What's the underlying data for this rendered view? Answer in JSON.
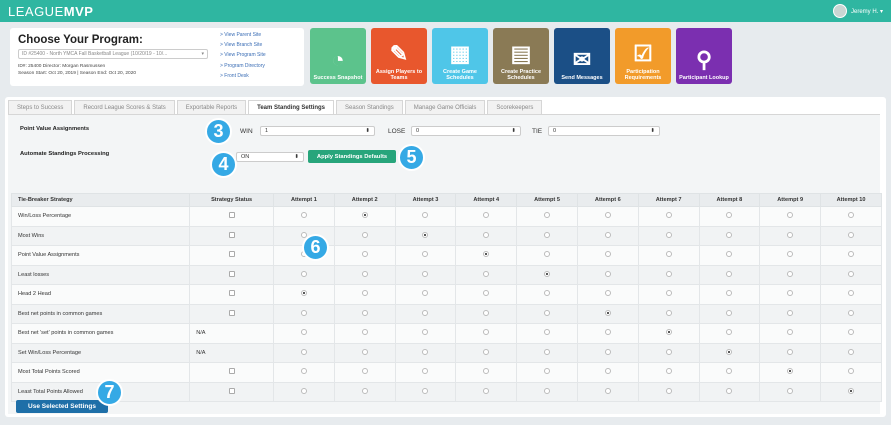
{
  "topbar": {
    "logo_a": "LEAGUE",
    "logo_b": "MVP",
    "user": "Jeremy H. ▾"
  },
  "program": {
    "title": "Choose Your Program:",
    "select": "ID #25400 - North YMCA Fall Basketball League (10/20/19 - 10/...",
    "meta1": "ID#: 25400       Director: Morgan Rasmussen",
    "meta2": "Season Start: Oct 20, 2019  |  Season End: Oct 20, 2020",
    "links": [
      "> View Parent Site",
      "> View Branch Site",
      "> View Program Site",
      "> Program Directory",
      "> Front Desk"
    ]
  },
  "tiles": [
    {
      "label": "Success Snapshot",
      "color": "#5cc38c",
      "icon": "gauge-icon",
      "glyph": "◔"
    },
    {
      "label": "Assign Players to Teams",
      "color": "#e8572d",
      "icon": "assign-icon",
      "glyph": "✎"
    },
    {
      "label": "Create Game Schedules",
      "color": "#4fc6e8",
      "icon": "calendar-icon",
      "glyph": "▦"
    },
    {
      "label": "Create Practice Schedules",
      "color": "#8a7a55",
      "icon": "practice-calendar-icon",
      "glyph": "▤"
    },
    {
      "label": "Send Messages",
      "color": "#1b4f86",
      "icon": "envelope-icon",
      "glyph": "✉"
    },
    {
      "label": "Participation Requirements",
      "color": "#f29b2a",
      "icon": "document-check-icon",
      "glyph": "☑"
    },
    {
      "label": "Participant Lookup",
      "color": "#7b2fb0",
      "icon": "search-icon",
      "glyph": "⚲"
    }
  ],
  "tabs": [
    "Steps to Success",
    "Record League Scores & Stats",
    "Exportable Reports",
    "Team Standing Settings",
    "Season Standings",
    "Manage Game Officials",
    "Scorekeepers"
  ],
  "active_tab": "Team Standing Settings",
  "settings": {
    "pva_label": "Point Value Assignments",
    "asp_label": "Automate Standings Processing",
    "win_label": "WIN",
    "win_value": "1",
    "lose_label": "LOSE",
    "lose_value": "0",
    "tie_label": "TIE",
    "tie_value": "0",
    "auto_value": "ON",
    "apply_label": "Apply Standings Defaults"
  },
  "badges": [
    "3",
    "4",
    "5",
    "6",
    "7"
  ],
  "table": {
    "headers": [
      "Tie-Breaker Strategy",
      "Strategy Status",
      "Attempt 1",
      "Attempt 2",
      "Attempt 3",
      "Attempt 4",
      "Attempt 5",
      "Attempt 6",
      "Attempt 7",
      "Attempt 8",
      "Attempt 9",
      "Attempt 10"
    ],
    "rows": [
      {
        "name": "Win/Loss Percentage",
        "status": "checkbox",
        "selected": 2
      },
      {
        "name": "Most Wins",
        "status": "checkbox",
        "selected": 3
      },
      {
        "name": "Point Value Assignments",
        "status": "checkbox",
        "selected": 4
      },
      {
        "name": "Least losses",
        "status": "checkbox",
        "selected": 5
      },
      {
        "name": "Head 2 Head",
        "status": "checkbox",
        "selected": 1
      },
      {
        "name": "Best net points in common games",
        "status": "checkbox",
        "selected": 6
      },
      {
        "name": "Best net 'set' points in common games",
        "status": "N/A",
        "selected": 7
      },
      {
        "name": "Set Win/Loss Percentage",
        "status": "N/A",
        "selected": 8
      },
      {
        "name": "Most Total Points Scored",
        "status": "checkbox",
        "selected": 9
      },
      {
        "name": "Least Total Points Allowed",
        "status": "checkbox",
        "selected": 10
      }
    ]
  },
  "use_label": "Use Selected Settings"
}
